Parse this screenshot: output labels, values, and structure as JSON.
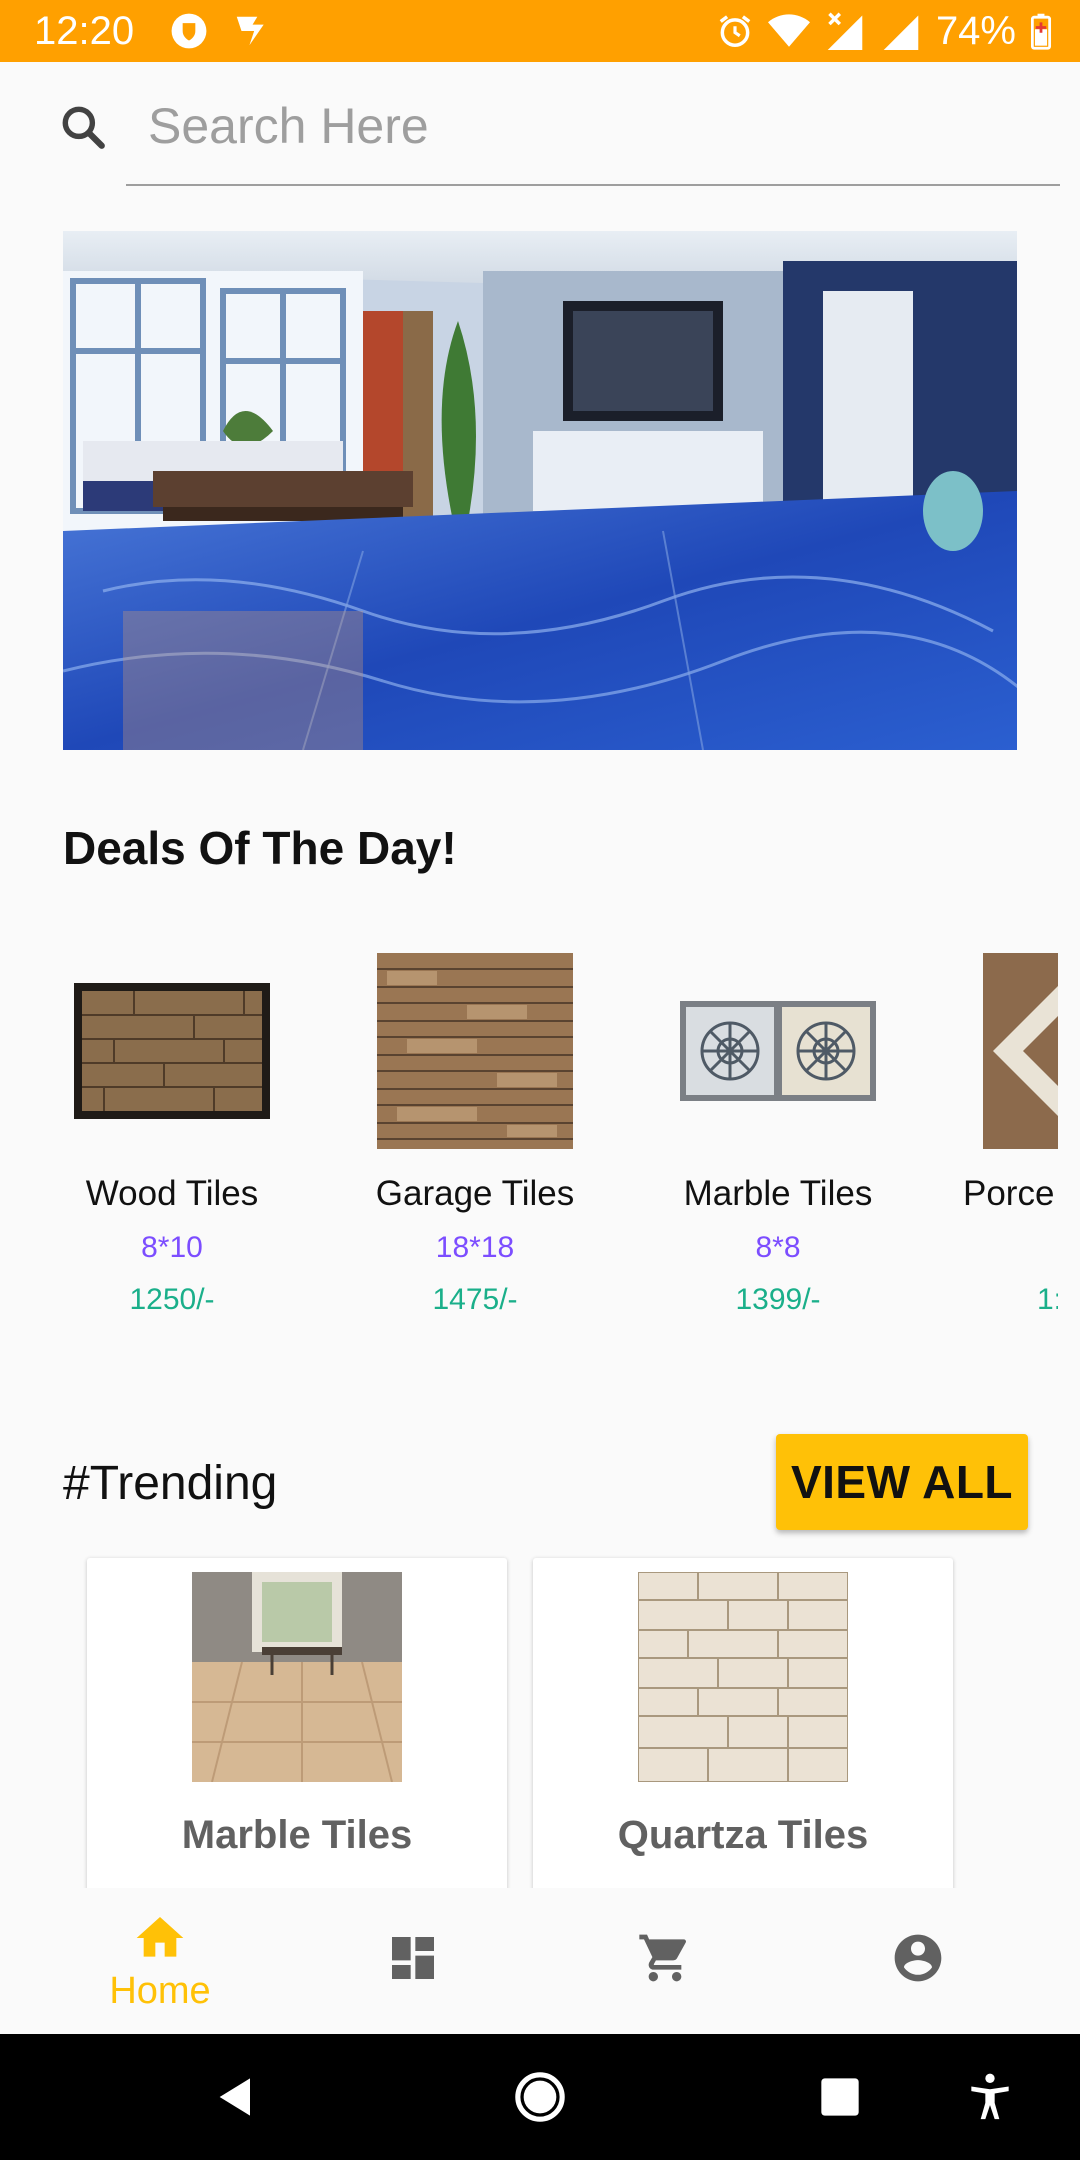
{
  "status_bar": {
    "time": "12:20",
    "battery": "74%",
    "bg_color": "#ffa000"
  },
  "search": {
    "placeholder": "Search Here",
    "icon": "search-icon"
  },
  "deals": {
    "title": "Deals Of The Day!",
    "items": [
      {
        "name": "Wood Tiles",
        "size": "8*10",
        "price": "1250/-"
      },
      {
        "name": "Garage Tiles",
        "size": "18*18",
        "price": "1475/-"
      },
      {
        "name": "Marble Tiles",
        "size": "8*8",
        "price": "1399/-"
      },
      {
        "name": "Porce",
        "size": "",
        "price": "1:"
      }
    ],
    "size_color": "#7c4dff",
    "price_color": "#1aaf8a"
  },
  "trending": {
    "title": "#Trending",
    "view_all_label": "VIEW ALL",
    "items": [
      {
        "name": "Marble Tiles"
      },
      {
        "name": "Quartza Tiles"
      }
    ]
  },
  "bottom_nav": {
    "items": [
      {
        "label": "Home",
        "icon": "home-icon",
        "active": true
      },
      {
        "label": "",
        "icon": "dashboard-icon",
        "active": false
      },
      {
        "label": "",
        "icon": "cart-icon",
        "active": false
      },
      {
        "label": "",
        "icon": "account-icon",
        "active": false
      }
    ],
    "active_color": "#ffc107",
    "inactive_color": "#616161"
  },
  "system_nav": {
    "buttons": [
      "back-icon",
      "home-circle-icon",
      "recents-icon",
      "accessibility-icon"
    ]
  }
}
